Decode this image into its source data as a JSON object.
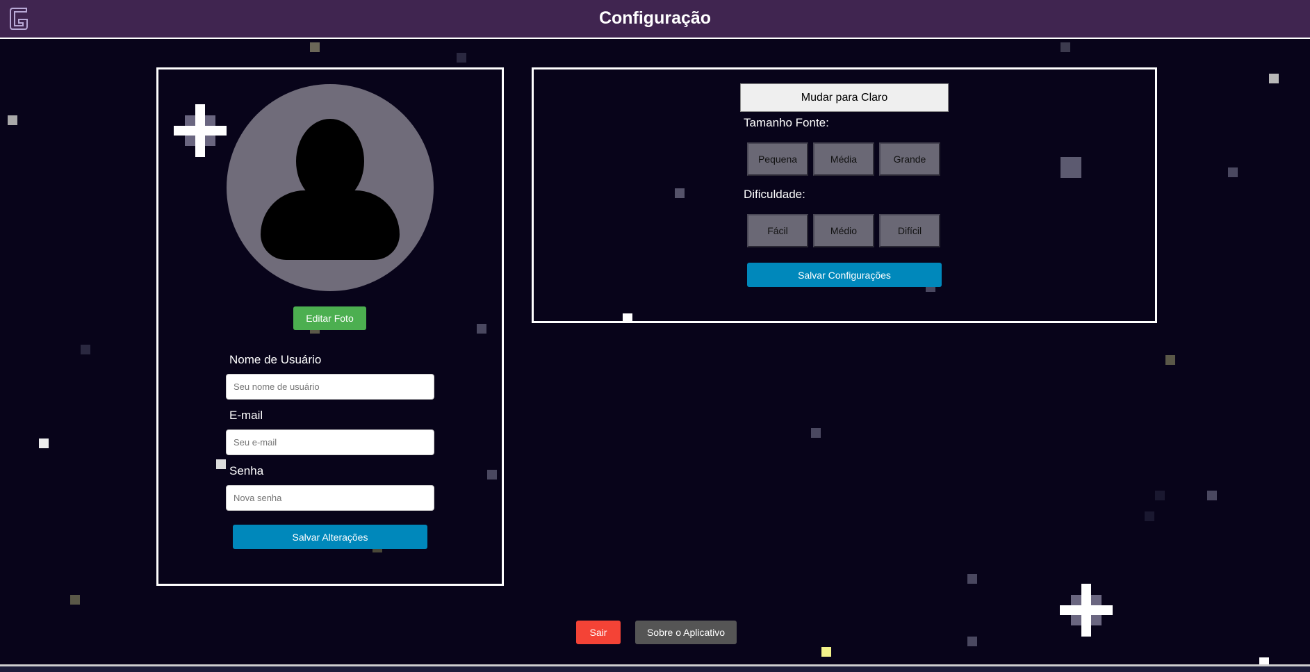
{
  "header": {
    "title": "Configuração",
    "logo_icon": "g-logo-icon"
  },
  "profile": {
    "avatar_icon": "user-avatar-icon",
    "edit_photo_label": "Editar Foto",
    "username_label": "Nome de Usuário",
    "username_placeholder": "Seu nome de usuário",
    "email_label": "E-mail",
    "email_placeholder": "Seu e-mail",
    "password_label": "Senha",
    "password_placeholder": "Nova senha",
    "save_label": "Salvar Alterações"
  },
  "settings": {
    "theme_toggle_label": "Mudar para Claro",
    "font_size_label": "Tamanho Fonte:",
    "font_sizes": [
      "Pequena",
      "Média",
      "Grande"
    ],
    "difficulty_label": "Dificuldade:",
    "difficulties": [
      "Fácil",
      "Médio",
      "Difícil"
    ],
    "save_label": "Salvar Configurações"
  },
  "footer": {
    "exit_label": "Sair",
    "about_label": "Sobre o Aplicativo"
  },
  "colors": {
    "background": "#08041a",
    "header": "#402550",
    "primary_blue": "#0088bb",
    "green": "#4caf50",
    "red": "#f44336"
  }
}
